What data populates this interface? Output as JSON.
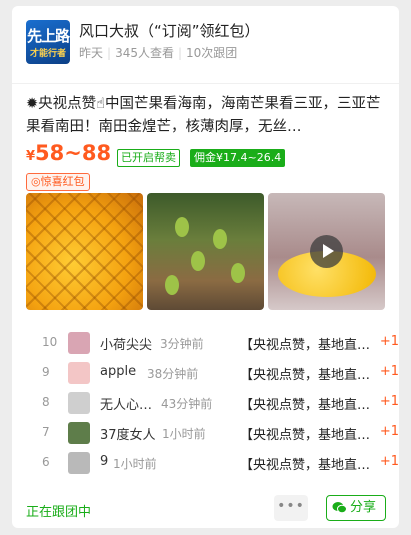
{
  "group": {
    "avatar_text_line1": "先上路",
    "avatar_text_line2": "才能行者",
    "name": "风口大叔（“订阅”领红包）",
    "meta_time": "昨天",
    "meta_views": "345人查看",
    "meta_follows": "10次跟团"
  },
  "post": {
    "title": "✹央视点赞☝中国芒果看海南，海南芒果看三亚，三亚芒果看南田！南田金煌芒，核薄肉厚，无丝…",
    "price_currency": "¥",
    "price_range": "58~88",
    "tag_help_sell": "已开启帮卖",
    "tag_commission": "佣金¥17.4~26.4",
    "tag_red_packet": "◎惊喜红包"
  },
  "followers": [
    {
      "rank": "10",
      "name": "小荷尖尖",
      "time": "3分钟前",
      "product": "【央视点赞，基地直发…",
      "count": "+1",
      "avatar_color": "#d9a5b3"
    },
    {
      "rank": "9",
      "name": "apple",
      "time": "38分钟前",
      "product": "【央视点赞，基地直发…",
      "count": "+1",
      "avatar_color": "#f3c6c6"
    },
    {
      "rank": "8",
      "name": "无人心…",
      "time": "43分钟前",
      "product": "【央视点赞，基地直发…",
      "count": "+1",
      "avatar_color": "#cfcfcf"
    },
    {
      "rank": "7",
      "name": "37度女人",
      "time": "1小时前",
      "product": "【央视点赞，基地直发…",
      "count": "+1",
      "avatar_color": "#5e7d4a"
    },
    {
      "rank": "6",
      "name": "9",
      "time": "1小时前",
      "product": "【央视点赞，基地直发…",
      "count": "+1",
      "avatar_color": "#b9b9b9"
    }
  ],
  "footer": {
    "status": "正在跟团中",
    "more_label": "•••",
    "share_label": "分享"
  },
  "colors": {
    "accent_green": "#1aad19",
    "price_orange": "#ff5a1f"
  }
}
